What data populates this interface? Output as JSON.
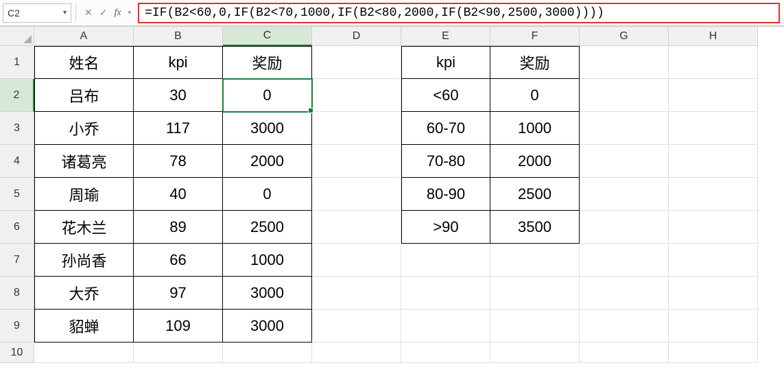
{
  "namebox": {
    "value": "C2"
  },
  "formula_bar": {
    "cancel_icon": "✕",
    "confirm_icon": "✓",
    "fx_label": "fx",
    "formula": "=IF(B2<60,0,IF(B2<70,1000,IF(B2<80,2000,IF(B2<90,2500,3000))))"
  },
  "columns": [
    "A",
    "B",
    "C",
    "D",
    "E",
    "F",
    "G",
    "H"
  ],
  "rows": [
    "1",
    "2",
    "3",
    "4",
    "5",
    "6",
    "7",
    "8",
    "9",
    "10"
  ],
  "selected_cell": "C2",
  "table_main": {
    "headers": {
      "A": "姓名",
      "B": "kpi",
      "C": "奖励"
    },
    "rows": [
      {
        "A": "吕布",
        "B": "30",
        "C": "0"
      },
      {
        "A": "小乔",
        "B": "117",
        "C": "3000"
      },
      {
        "A": "诸葛亮",
        "B": "78",
        "C": "2000"
      },
      {
        "A": "周瑜",
        "B": "40",
        "C": "0"
      },
      {
        "A": "花木兰",
        "B": "89",
        "C": "2500"
      },
      {
        "A": "孙尚香",
        "B": "66",
        "C": "1000"
      },
      {
        "A": "大乔",
        "B": "97",
        "C": "3000"
      },
      {
        "A": "貂蝉",
        "B": "109",
        "C": "3000"
      }
    ]
  },
  "table_ref": {
    "headers": {
      "E": "kpi",
      "F": "奖励"
    },
    "rows": [
      {
        "E": "<60",
        "F": "0"
      },
      {
        "E": "60-70",
        "F": "1000"
      },
      {
        "E": "70-80",
        "F": "2000"
      },
      {
        "E": "80-90",
        "F": "2500"
      },
      {
        "E": ">90",
        "F": "3500"
      }
    ]
  },
  "autofill_icon": "▦"
}
